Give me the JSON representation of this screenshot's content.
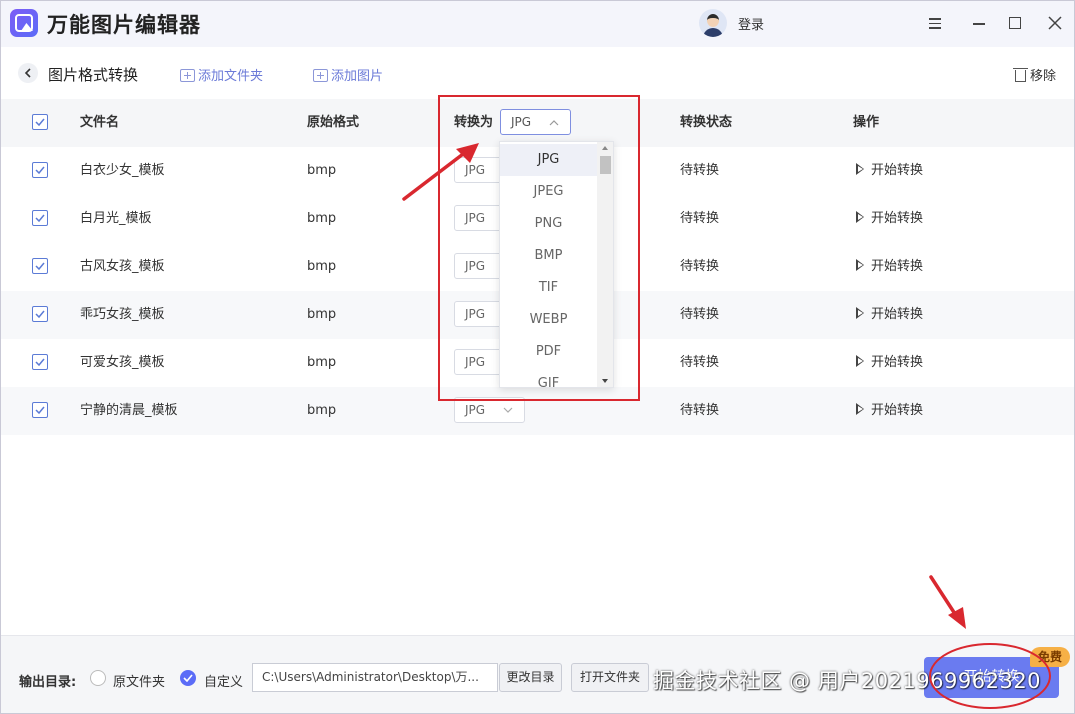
{
  "app": {
    "title": "万能图片编辑器",
    "login_label": "登录"
  },
  "toolbar": {
    "page_title": "图片格式转换",
    "add_folder_label": "添加文件夹",
    "add_image_label": "添加图片",
    "remove_label": "移除"
  },
  "table": {
    "headers": {
      "filename": "文件名",
      "original_format": "原始格式",
      "convert_to": "转换为",
      "convert_to_value": "JPG",
      "status": "转换状态",
      "action": "操作"
    },
    "rows": [
      {
        "name": "白衣少女_模板",
        "format": "bmp",
        "target": "JPG",
        "status": "待转换",
        "action": "开始转换"
      },
      {
        "name": "白月光_模板",
        "format": "bmp",
        "target": "JPG",
        "status": "待转换",
        "action": "开始转换"
      },
      {
        "name": "古风女孩_模板",
        "format": "bmp",
        "target": "JPG",
        "status": "待转换",
        "action": "开始转换"
      },
      {
        "name": "乖巧女孩_模板",
        "format": "bmp",
        "target": "JPG",
        "status": "待转换",
        "action": "开始转换"
      },
      {
        "name": "可爱女孩_模板",
        "format": "bmp",
        "target": "JPG",
        "status": "待转换",
        "action": "开始转换"
      },
      {
        "name": "宁静的清晨_模板",
        "format": "bmp",
        "target": "JPG",
        "status": "待转换",
        "action": "开始转换"
      }
    ]
  },
  "dropdown": {
    "options": [
      "JPG",
      "JPEG",
      "PNG",
      "BMP",
      "TIF",
      "WEBP",
      "PDF",
      "GIF"
    ],
    "selected": "JPG"
  },
  "footer": {
    "output_label": "输出目录:",
    "option_original": "原文件夹",
    "option_custom": "自定义",
    "selected_option": "自定义",
    "path_value": "C:\\Users\\Administrator\\Desktop\\万...",
    "change_dir_label": "更改目录",
    "open_folder_label": "打开文件夹",
    "start_label": "开始转换",
    "free_badge": "免费"
  },
  "watermark": "掘金技术社区 @ 用户2021969962320",
  "colors": {
    "accent": "#5b6cf7",
    "annotation_red": "#d9282f",
    "badge": "#f6b046"
  }
}
